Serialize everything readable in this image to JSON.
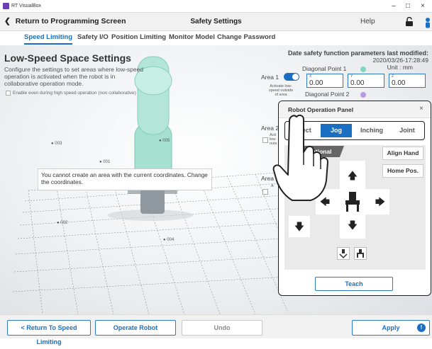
{
  "window": {
    "app_title": "RT VisualBox",
    "minimize": "–",
    "maximize": "□",
    "close": "×"
  },
  "header": {
    "back_label": "Return to Programming Screen",
    "title": "Safety Settings",
    "help": "Help"
  },
  "tabs": [
    {
      "label": "Speed Limiting",
      "active": true
    },
    {
      "label": "Safety I/O"
    },
    {
      "label": "Position Limiting"
    },
    {
      "label": "Monitor Model"
    },
    {
      "label": "Change Password"
    }
  ],
  "lowspeed": {
    "heading": "Low-Speed Space Settings",
    "description": "Configure the settings to set areas where low-speed operation is activated when the robot is in collaborative operation mode.",
    "enable_label": "Enable even during high speed operation (non collaborative)"
  },
  "scene_points": [
    "003",
    "005",
    "001",
    "002",
    "004"
  ],
  "message": "You cannot create an area with the current coordinates. Change the coordinates.",
  "date_info": {
    "line1": "Date safety function parameters last modified:",
    "line2": "2020/03/26-17:28:49",
    "unit": "Unit : mm"
  },
  "area1": {
    "label": "Area 1",
    "diag1": "Diagonal Point 1",
    "diag2": "Diagonal Point 2",
    "activate_text": "Activate low-speed outside of area",
    "x_label": "X",
    "y_label": "Y",
    "z_label": "Z",
    "x": "0.00",
    "y": "0.00",
    "z": "0.00",
    "dot1_color": "#7fd6c4",
    "dot2_color": "#b89be0"
  },
  "area2": {
    "label": "Area 2",
    "activate_partial": "Acti low- outs"
  },
  "area3": {
    "label": "Area",
    "partial": "A"
  },
  "panel": {
    "title": "Robot Operation Panel",
    "close": "×",
    "modes": [
      "Direct",
      "Jog",
      "Inching",
      "Joint"
    ],
    "active_mode": "Jog",
    "translational": "Translational",
    "align_hand": "Align Hand",
    "home_pos": "Home Pos.",
    "teach": "Teach"
  },
  "footer": {
    "return_speed": "< Return To Speed Limiting",
    "operate_robot": "Operate Robot",
    "undo": "Undo",
    "apply": "Apply",
    "apply_badge": "!"
  },
  "colors": {
    "accent": "#1a6fc2",
    "robot_teal": "#9fdccb",
    "robot_body": "#9aa3a9"
  }
}
